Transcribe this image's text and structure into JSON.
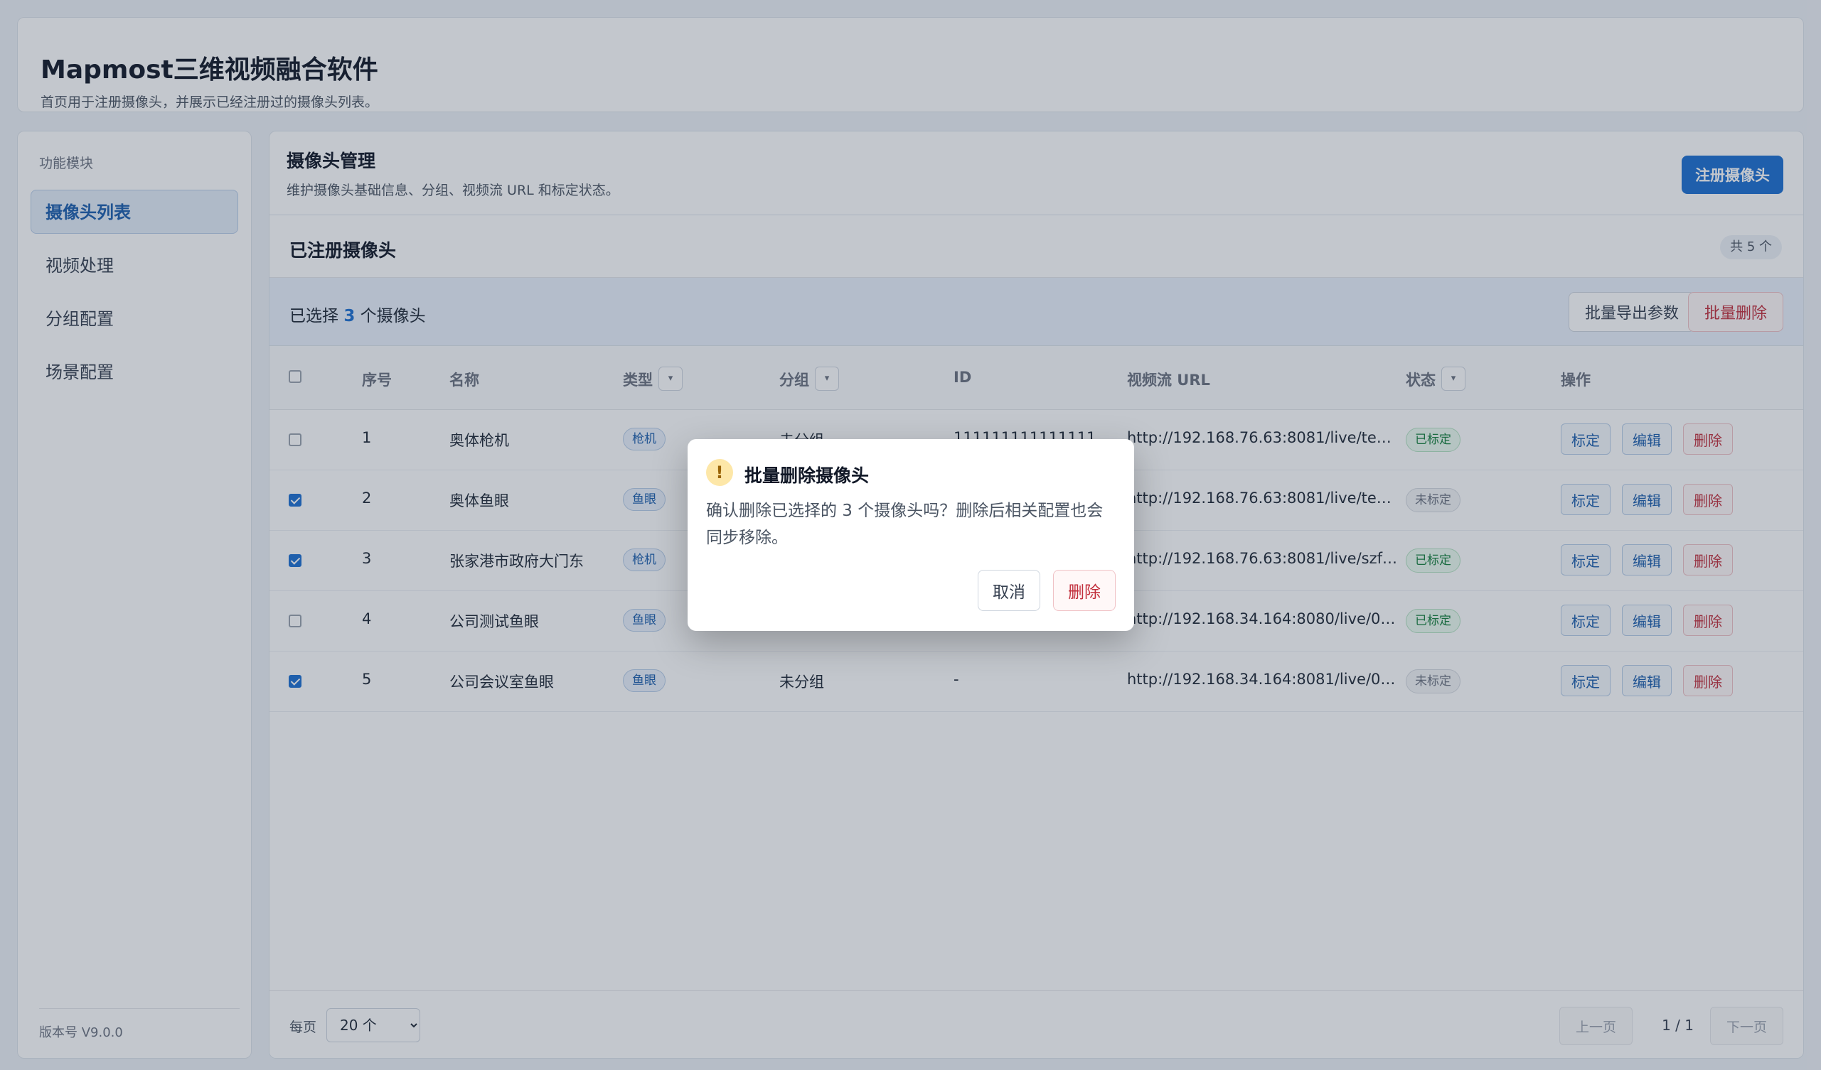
{
  "app": {
    "title": "Mapmost三维视频融合软件",
    "description": "首页用于注册摄像头，并展示已经注册过的摄像头列表。"
  },
  "sidebar": {
    "caption": "功能模块",
    "items": [
      {
        "label": "摄像头列表",
        "active": true
      },
      {
        "label": "视频处理",
        "active": false
      },
      {
        "label": "分组配置",
        "active": false
      },
      {
        "label": "场景配置",
        "active": false
      }
    ],
    "version": "版本号 V9.0.0"
  },
  "panel": {
    "title": "摄像头管理",
    "description": "维护摄像头基础信息、分组、视频流 URL 和标定状态。",
    "register_button": "注册摄像头"
  },
  "list": {
    "title": "已注册摄像头",
    "count_badge": "共 5 个"
  },
  "selection": {
    "prefix": "已选择",
    "count": "3",
    "suffix": "个摄像头",
    "export_button": "批量导出参数",
    "batch_delete_button": "批量删除"
  },
  "table": {
    "headers": {
      "index": "序号",
      "name": "名称",
      "type": "类型",
      "group": "分组",
      "id": "ID",
      "url": "视频流 URL",
      "status": "状态",
      "actions": "操作"
    },
    "filter_glyph": "▾",
    "action_labels": {
      "calibrate": "标定",
      "edit": "编辑",
      "delete": "删除"
    },
    "rows": [
      {
        "checked": false,
        "index": "1",
        "name": "奥体枪机",
        "type": "枪机",
        "group": "未分组",
        "id": "111111111111111",
        "url": "http://192.168.76.63:8081/live/te…",
        "status": "已标定",
        "status_kind": "ok"
      },
      {
        "checked": true,
        "index": "2",
        "name": "奥体鱼眼",
        "type": "鱼眼",
        "group": "",
        "id": "",
        "url": "http://192.168.76.63:8081/live/te…",
        "status": "未标定",
        "status_kind": "no"
      },
      {
        "checked": true,
        "index": "3",
        "name": "张家港市政府大门东",
        "type": "枪机",
        "group": "",
        "id": "",
        "url": "http://192.168.76.63:8081/live/szf…",
        "status": "已标定",
        "status_kind": "ok"
      },
      {
        "checked": false,
        "index": "4",
        "name": "公司测试鱼眼",
        "type": "鱼眼",
        "group": "",
        "id": "",
        "url": "http://192.168.34.164:8080/live/0…",
        "status": "已标定",
        "status_kind": "ok"
      },
      {
        "checked": true,
        "index": "5",
        "name": "公司会议室鱼眼",
        "type": "鱼眼",
        "group": "未分组",
        "id": "-",
        "url": "http://192.168.34.164:8081/live/0…",
        "status": "未标定",
        "status_kind": "no"
      }
    ]
  },
  "pagination": {
    "per_page_label": "每页",
    "per_page_value": "20 个",
    "prev": "上一页",
    "info": "1 / 1",
    "next": "下一页"
  },
  "dialog": {
    "icon": "!",
    "title": "批量删除摄像头",
    "message": "确认删除已选择的 3 个摄像头吗？删除后相关配置也会同步移除。",
    "cancel": "取消",
    "confirm": "删除"
  }
}
